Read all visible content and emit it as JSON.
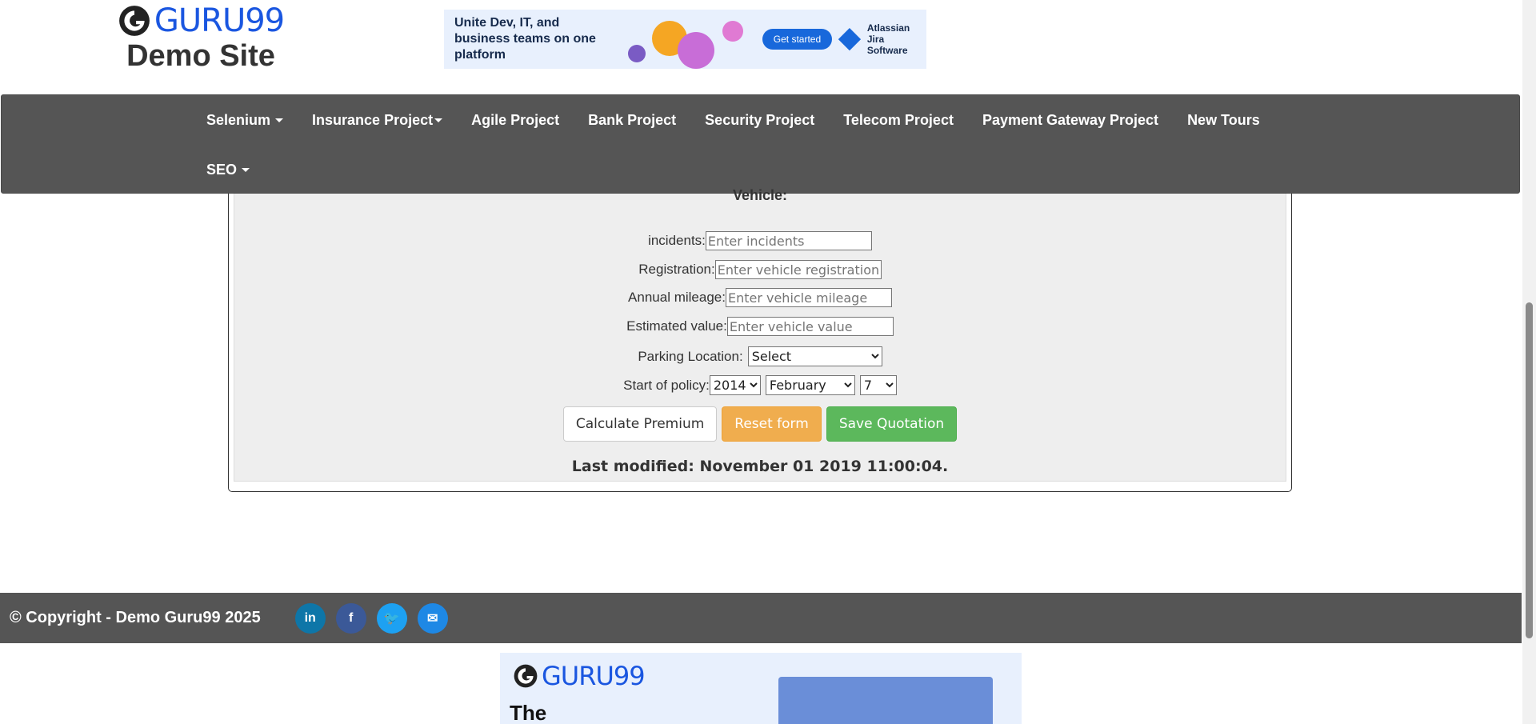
{
  "header": {
    "logo_text": "GURU99",
    "logo_subtitle": "Demo Site"
  },
  "ad_top": {
    "text": "Unite Dev, IT, and business teams on one platform",
    "cta": "Get started",
    "brand_line1": "Atlassian",
    "brand_line2": "Jira Software"
  },
  "nav": {
    "row1": [
      {
        "label": "Selenium",
        "dropdown": true
      },
      {
        "label": "Insurance Project",
        "dropdown": true
      },
      {
        "label": "Agile Project",
        "dropdown": false
      },
      {
        "label": "Bank Project",
        "dropdown": false
      },
      {
        "label": "Security Project",
        "dropdown": false
      },
      {
        "label": "Telecom Project",
        "dropdown": false
      },
      {
        "label": "Payment Gateway Project",
        "dropdown": false
      },
      {
        "label": "New Tours",
        "dropdown": false
      }
    ],
    "row2": [
      {
        "label": "SEO",
        "dropdown": true
      }
    ]
  },
  "form": {
    "partial_heading": "Vehicle:",
    "incidents": {
      "label": "incidents:",
      "placeholder": "Enter incidents",
      "value": ""
    },
    "registration": {
      "label": "Registration:",
      "placeholder": "Enter vehicle registration",
      "value": ""
    },
    "mileage": {
      "label": "Annual mileage:",
      "placeholder": "Enter vehicle mileage",
      "value": ""
    },
    "estimated_value": {
      "label": "Estimated value:",
      "placeholder": "Enter vehicle value",
      "value": ""
    },
    "parking": {
      "label": "Parking Location:",
      "selected": "Select"
    },
    "start_policy": {
      "label": "Start of policy:",
      "year": "2014",
      "month": "February",
      "day": "7"
    },
    "buttons": {
      "calculate": "Calculate Premium",
      "reset": "Reset form",
      "save": "Save Quotation"
    },
    "last_modified": "Last modified: November 01 2019 11:00:04."
  },
  "footer": {
    "copyright": "© Copyright - Demo Guru99 2025",
    "social": [
      {
        "icon": "linkedin-icon",
        "glyph": "in",
        "color": "#0e76a8"
      },
      {
        "icon": "facebook-icon",
        "glyph": "f",
        "color": "#3b5998"
      },
      {
        "icon": "twitter-icon",
        "glyph": "🐦",
        "color": "#1da1f2"
      },
      {
        "icon": "email-icon",
        "glyph": "✉",
        "color": "#1e88e5"
      }
    ]
  },
  "ad_bottom": {
    "logo_text": "GURU99",
    "text": "The"
  },
  "colors": {
    "nav_bg": "#555555",
    "brand_blue": "#1a56e0",
    "warning": "#f0ad4e",
    "success": "#5cb85c"
  }
}
